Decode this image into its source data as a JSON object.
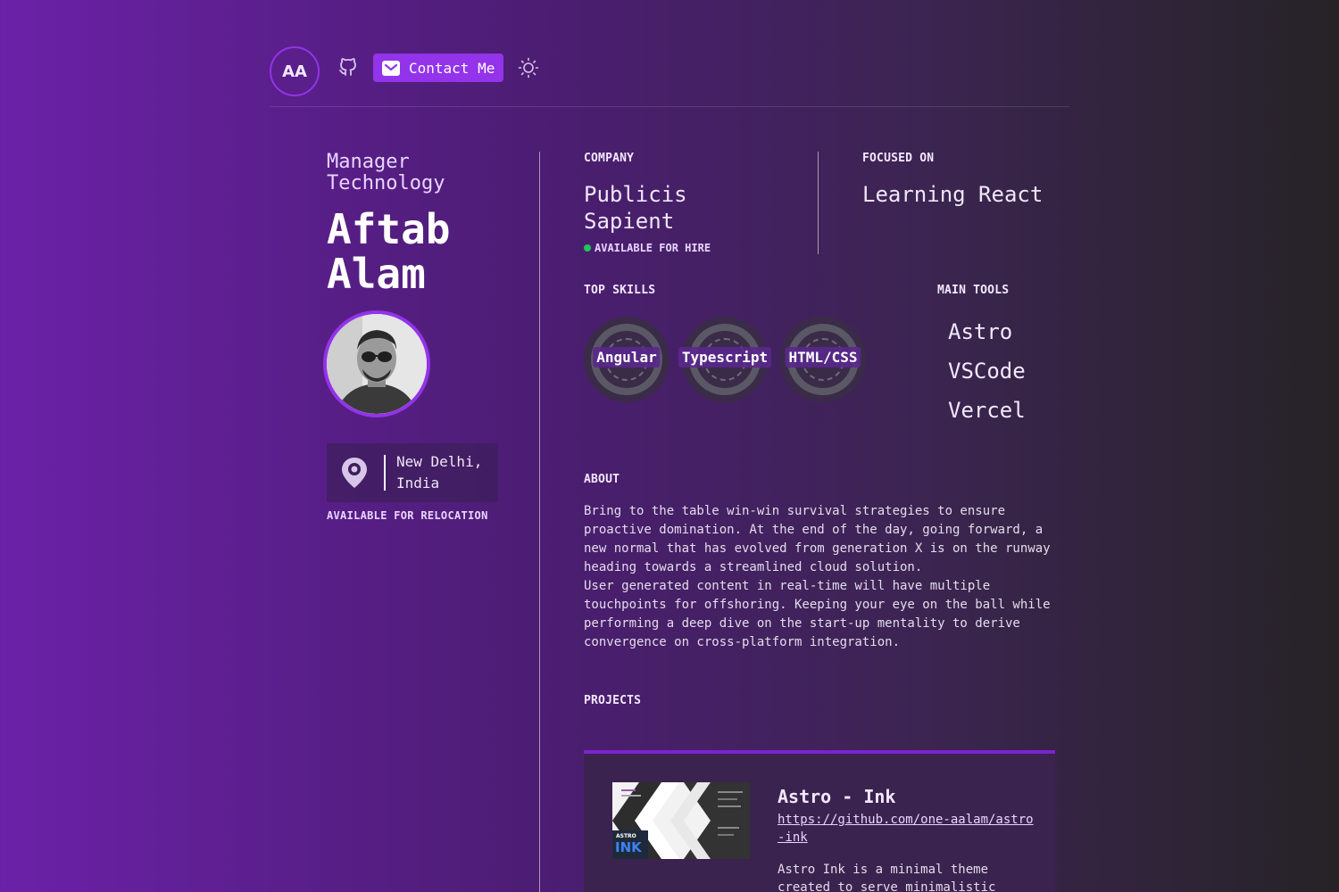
{
  "header": {
    "logo_initials": "AA",
    "contact_label": "Contact Me"
  },
  "profile": {
    "role_line1": "Manager",
    "role_line2": "Technology",
    "name_line1": "Aftab",
    "name_line2": "Alam",
    "location_line1": "New Delhi,",
    "location_line2": "India",
    "relocation": "AVAILABLE FOR RELOCATION"
  },
  "company": {
    "label": "COMPANY",
    "name_line1": "Publicis",
    "name_line2": "Sapient",
    "hire_status": "AVAILABLE FOR HIRE",
    "hire_color": "#22c55e"
  },
  "focused": {
    "label": "FOCUSED ON",
    "value": "Learning React"
  },
  "skills": {
    "label": "TOP SKILLS",
    "items": [
      "Angular",
      "Typescript",
      "HTML/CSS"
    ]
  },
  "tools": {
    "label": "MAIN TOOLS",
    "items": [
      "Astro",
      "VSCode",
      "Vercel"
    ]
  },
  "about": {
    "label": "ABOUT",
    "line1": "Bring to the table win-win survival strategies to ensure",
    "line2": "proactive domination. At the end of the day, going forward, a",
    "line3": "new normal that has evolved from generation X is on the runway",
    "line4": "heading towards a streamlined cloud solution.",
    "line5": "User generated content in real-time will have multiple",
    "line6": "touchpoints for offshoring. Keeping your eye on the ball while",
    "line7": "performing a deep dive on the start-up mentality to derive",
    "line8": "convergence on cross-platform integration."
  },
  "projects": {
    "label": "PROJECTS",
    "items": [
      {
        "title": "Astro - Ink",
        "url": "https://github.com/one-aalam/astro-ink",
        "description_line1": "Astro Ink is a minimal theme",
        "description_line2": "created to serve minimalistic",
        "thumb_text_top": "ASTRO",
        "thumb_text_big": "INK"
      }
    ]
  },
  "colors": {
    "accent": "#9333ea",
    "card_border": "#7e22ce"
  },
  "icons": [
    "github-icon",
    "mail-icon",
    "sun-icon",
    "map-pin-icon"
  ]
}
